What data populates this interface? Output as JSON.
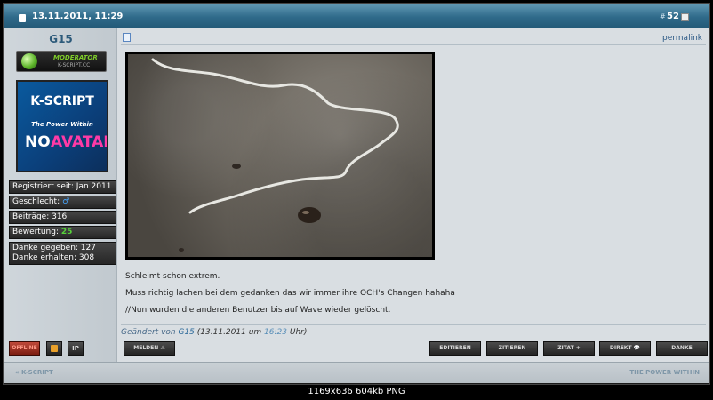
{
  "header": {
    "date": "13.11.2011, 11:29",
    "post_hash": "#",
    "post_number": "52"
  },
  "user": {
    "name": "G15",
    "badge_title": "MODERATOR",
    "badge_sub": "K-SCRIPT.CC",
    "avatar_top": "K-SCRIPT",
    "avatar_tagline": "The Power Within",
    "avatar_no": "NO",
    "avatar_avatar": "AVATAR",
    "stats": {
      "registered": "Registriert seit: Jan 2011",
      "gender_label": "Geschlecht:",
      "gender_symbol": "♂",
      "posts": "Beiträge: 316",
      "rating_label": "Bewertung:",
      "rating_value": "25",
      "thanks_given": "Danke gegeben: 127",
      "thanks_received": "Danke erhalten: 308"
    },
    "offline_label": "OFFLINE",
    "ip_label": "IP"
  },
  "post": {
    "permalink": "permalink",
    "lines": [
      "Schleimt schon extrem.",
      "Muss richtig lachen bei dem gedanken das wir immer ihre OCH's Changen hahaha",
      "//Nun wurden die anderen Benutzer bis auf Wave wieder gelöscht."
    ],
    "edited_label": "Geändert von",
    "edited_user": "G15",
    "edited_date": "(13.11.2011 um",
    "edited_time": "16:23",
    "edited_suffix": "Uhr)"
  },
  "actions": {
    "report": "MELDEN ⚠",
    "edit": "EDITIEREN",
    "quote": "ZITIEREN",
    "quote_plus": "ZITAT +",
    "direct": "DIREKT 💬",
    "thanks": "DANKE"
  },
  "footer": {
    "left": "« K-SCRIPT",
    "right": "THE POWER WITHIN"
  },
  "caption": "1169x636  604kb  PNG"
}
